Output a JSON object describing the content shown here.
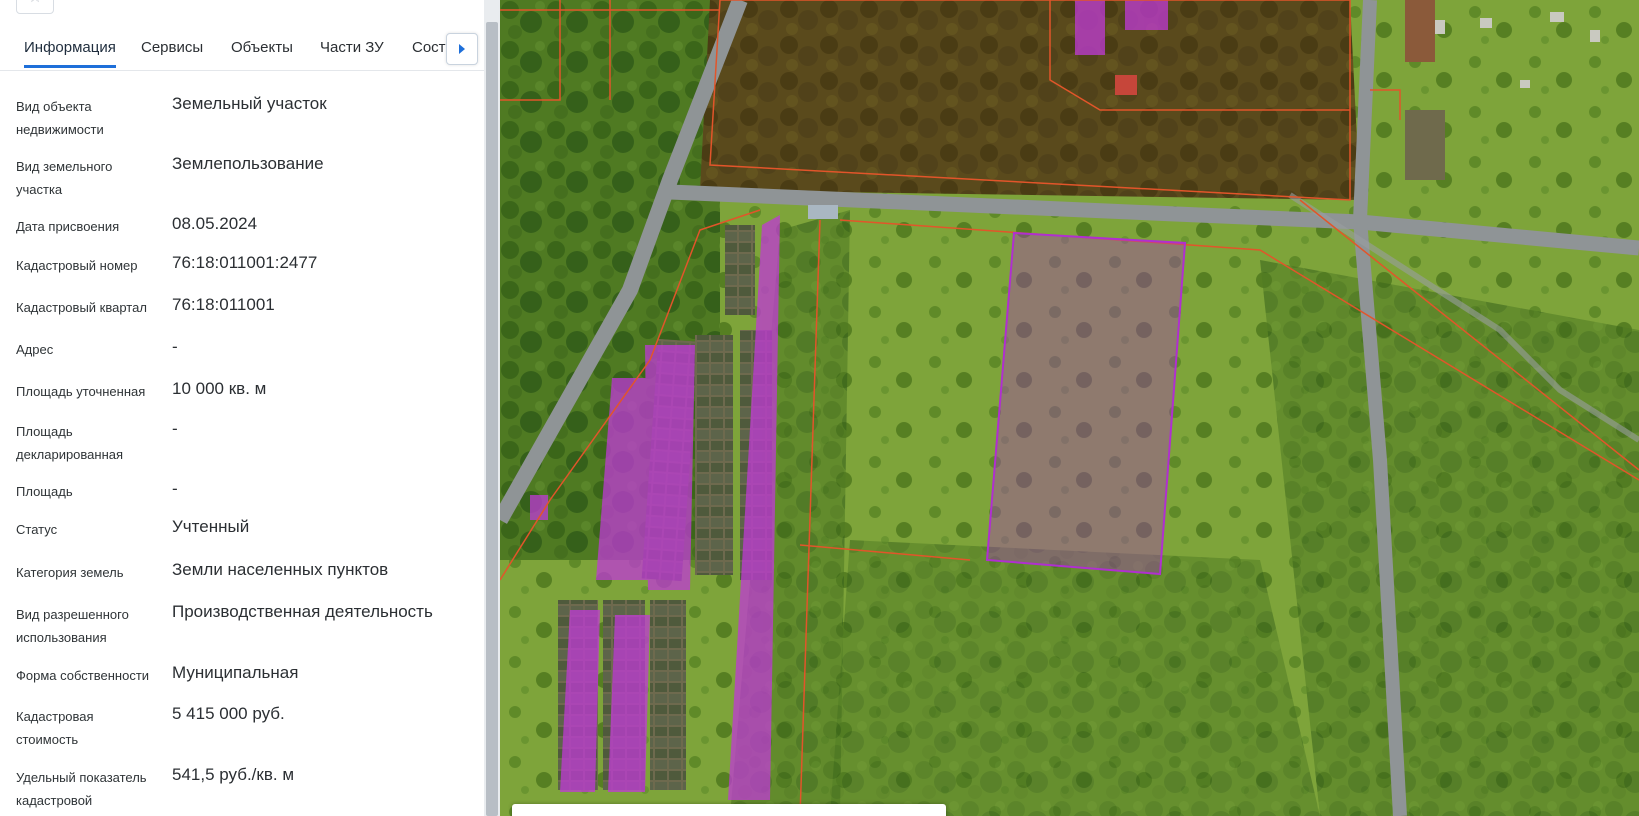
{
  "tabs": [
    "Информация",
    "Сервисы",
    "Объекты",
    "Части ЗУ",
    "Соста"
  ],
  "properties": [
    {
      "label": "Вид объекта недвижимости",
      "value": "Земельный участок"
    },
    {
      "label": "Вид земельного участка",
      "value": "Землепользование"
    },
    {
      "label": "Дата присвоения",
      "value": "08.05.2024"
    },
    {
      "label": "Кадастровый номер",
      "value": "76:18:011001:2477"
    },
    {
      "label": "Кадастровый квартал",
      "value": "76:18:011001"
    },
    {
      "label": "Адрес",
      "value": "-"
    },
    {
      "label": "Площадь уточненная",
      "value": "10 000 кв. м"
    },
    {
      "label": "Площадь декларированная",
      "value": "-"
    },
    {
      "label": "Площадь",
      "value": "-"
    },
    {
      "label": "Статус",
      "value": "Учтенный"
    },
    {
      "label": "Категория земель",
      "value": "Земли населенных пунктов"
    },
    {
      "label": "Вид разрешенного использования",
      "value": "Производственная деятельность"
    },
    {
      "label": "Форма собственности",
      "value": "Муниципальная"
    },
    {
      "label": "Кадастровая стоимость",
      "value": "5 415 000 руб."
    },
    {
      "label": "Удельный показатель кадастровой",
      "value": "541,5 руб./кв. м"
    }
  ],
  "icons": {
    "top_button": "star-icon",
    "tab_next": "chevron-right-icon"
  },
  "colors": {
    "accent": "#1e6fd9",
    "parcel_highlight": "#b02fd0",
    "boundary": "#e2552a"
  }
}
